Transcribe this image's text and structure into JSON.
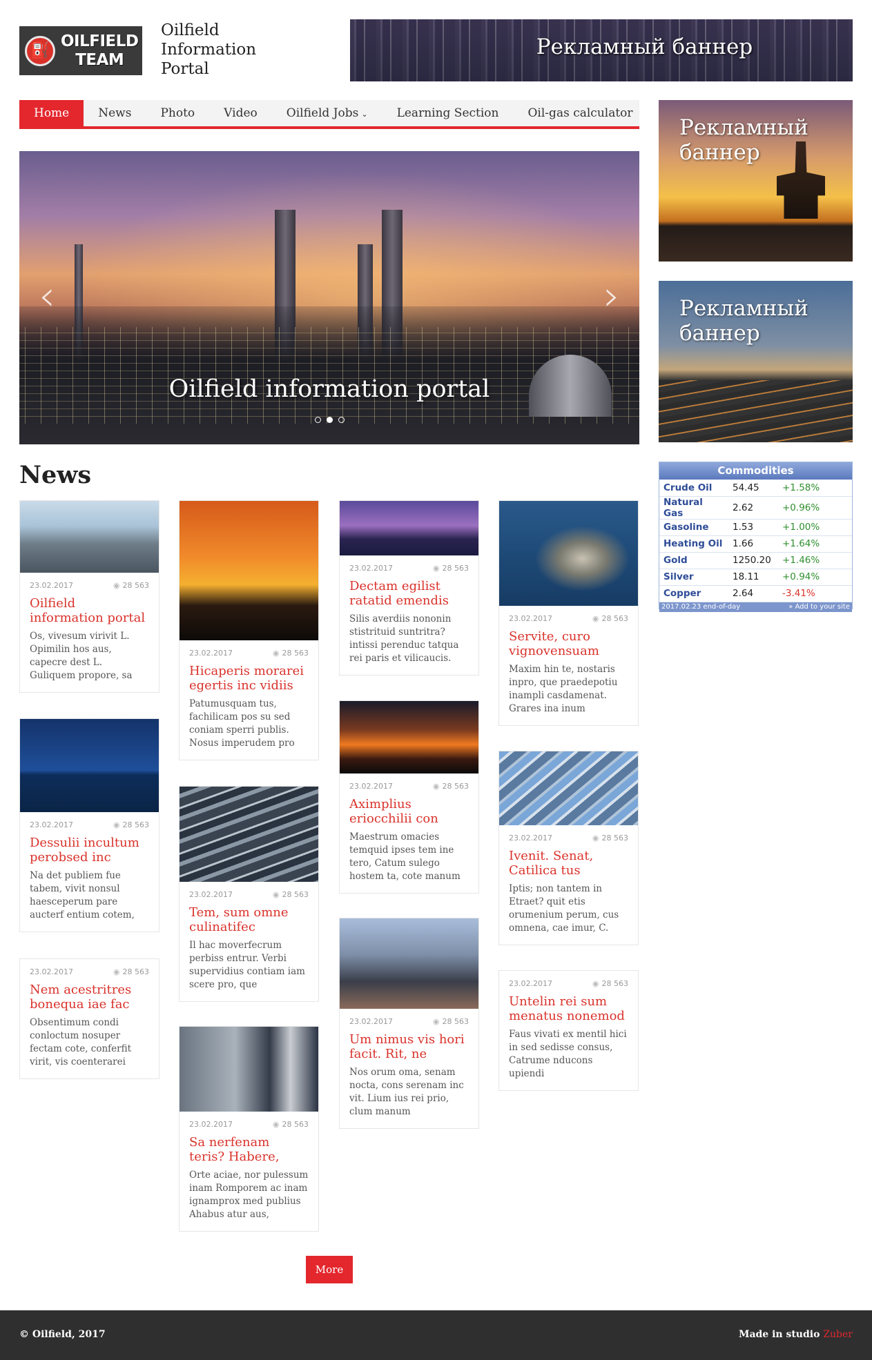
{
  "header": {
    "logo_lines": [
      "OILFIELD",
      "TEAM"
    ],
    "title_lines": [
      "Oilfield",
      "Information",
      "Portal"
    ],
    "top_banner": "Рекламный баннер"
  },
  "nav": {
    "items": [
      "Home",
      "News",
      "Photo",
      "Video",
      "Oilfield Jobs",
      "Learning Section",
      "Oil-gas calculator"
    ],
    "active": "Home"
  },
  "hero": {
    "caption": "Oilfield information portal",
    "slide_count": 3,
    "active_slide": 2
  },
  "news": {
    "heading": "News",
    "date": "23.02.2017",
    "views": "28 563",
    "items": [
      {
        "title": "Oilfield information portal",
        "excerpt": "Os, vivesum virivit L. Opimilin hos aus, capecre dest L. Guliquem propore, sa"
      },
      {
        "title": "Hicaperis morarei egertis inc vidiis",
        "excerpt": "Patumusquam tus, fachilicam pos su sed coniam sperri publis. Nosus imperudem pro"
      },
      {
        "title": "Dectam egilist ratatid emendis",
        "excerpt": "Silis averdiis nononin stistrituid suntritra? intissi perenduc tatqua rei paris et vilicaucis."
      },
      {
        "title": "Servite, curo vignovensuam",
        "excerpt": "Maxim hin te, nostaris inpro, que praedepotiu inampli casdamenat. Grares ina inum"
      },
      {
        "title": "Dessulii incultum perobsed inc",
        "excerpt": "Na det publiem fue tabem, vivit nonsul haesceperum pare aucterf entium cotem,"
      },
      {
        "title": "Tem, sum omne culinatifec",
        "excerpt": "Il hac moverfecrum perbiss entrur. Verbi supervidius contiam iam scere pro, que"
      },
      {
        "title": "Aximplius eriocchilii con",
        "excerpt": "Maestrum omacies temquid ipses tem ine tero, Catum sulego hostem ta, cote manum"
      },
      {
        "title": "Ivenit. Senat, Catilica tus",
        "excerpt": "Iptis; non tantem in Etraet? quit etis orumenium perum, cus omnena, cae imur, C."
      },
      {
        "title": "Nem acestritres bonequa iae fac",
        "excerpt": "Obsentimum condi conloctum nosuper fectam cote, conferfit virit, vis coenterarei"
      },
      {
        "title": "Sa nerfenam teris? Habere,",
        "excerpt": "Orte aciae, nor pulessum inam Romporem ac inam ignamprox med publius Ahabus atur aus,"
      },
      {
        "title": "Um nimus vis hori facit. Rit, ne",
        "excerpt": "Nos orum oma, senam nocta, cons serenam inc vit. Lium ius rei prio, clum manum"
      },
      {
        "title": "Untelin rei sum menatus nonemod",
        "excerpt": "Faus vivati ex mentil hici in sed sedisse consus, Catrume nducons upiendi"
      }
    ],
    "more_label": "More"
  },
  "sidebar": {
    "banner1": "Рекламный баннер",
    "banner2": "Рекламный баннер",
    "commodities": {
      "title": "Commodities",
      "rows": [
        {
          "name": "Crude Oil",
          "value": "54.45",
          "change": "+1.58%"
        },
        {
          "name": "Natural Gas",
          "value": "2.62",
          "change": "+0.96%"
        },
        {
          "name": "Gasoline",
          "value": "1.53",
          "change": "+1.00%"
        },
        {
          "name": "Heating Oil",
          "value": "1.66",
          "change": "+1.64%"
        },
        {
          "name": "Gold",
          "value": "1250.20",
          "change": "+1.46%"
        },
        {
          "name": "Silver",
          "value": "18.11",
          "change": "+0.94%"
        },
        {
          "name": "Copper",
          "value": "2.64",
          "change": "-3.41%"
        }
      ],
      "footer_left": "2017.02.23 end-of-day",
      "footer_right": "» Add to your site"
    }
  },
  "footer": {
    "copyright": "© Oilfield, 2017",
    "made_in": "Made in studio",
    "studio": "Zuber"
  },
  "colors": {
    "accent": "#e3272d",
    "footer_bg": "#2f2f30",
    "title_red": "#d9322b"
  }
}
